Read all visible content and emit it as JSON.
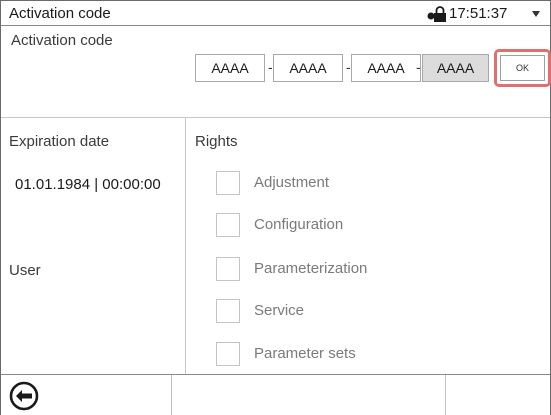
{
  "header": {
    "title": "Activation code",
    "time": "17:51:37",
    "lock_icon": "lock-icon",
    "dropdown_icon": "chevron-down-icon"
  },
  "activation": {
    "label": "Activation code",
    "fields": [
      "AAAA",
      "AAAA",
      "AAAA",
      "AAAA"
    ],
    "separator": "-",
    "ok_label": "OK",
    "highlight_color": "#e07070"
  },
  "info": {
    "expiration_label": "Expiration date",
    "expiration_value": "01.01.1984 | 00:00:00",
    "user_label": "User"
  },
  "rights": {
    "title": "Rights",
    "items": [
      {
        "label": "Adjustment",
        "checked": false
      },
      {
        "label": "Configuration",
        "checked": false
      },
      {
        "label": "Parameterization",
        "checked": false
      },
      {
        "label": "Service",
        "checked": false
      },
      {
        "label": "Parameter sets",
        "checked": false
      }
    ]
  },
  "footer": {
    "back_icon": "back-arrow-icon"
  }
}
